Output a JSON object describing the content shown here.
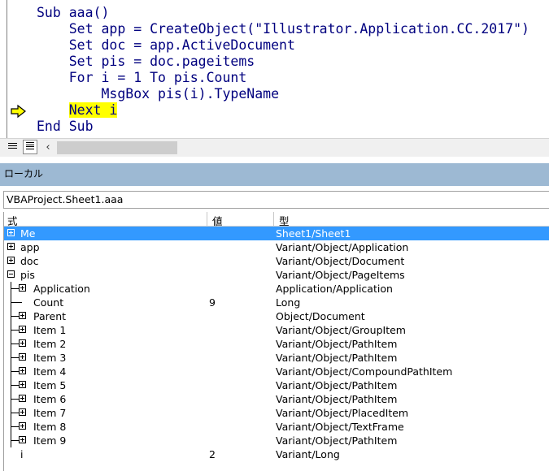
{
  "code": {
    "lines": [
      {
        "pre": "Sub aaa()",
        "hl": "",
        "post": ""
      },
      {
        "pre": "    Set app = CreateObject(\"Illustrator.Application.CC.2017\")",
        "hl": "",
        "post": ""
      },
      {
        "pre": "    Set doc = app.ActiveDocument",
        "hl": "",
        "post": ""
      },
      {
        "pre": "    Set pis = doc.pageitems",
        "hl": "",
        "post": ""
      },
      {
        "pre": "    For i = 1 To pis.Count",
        "hl": "",
        "post": ""
      },
      {
        "pre": "        MsgBox pis(i).TypeName",
        "hl": "",
        "post": ""
      },
      {
        "pre": "    ",
        "hl": "Next i",
        "post": ""
      },
      {
        "pre": "End Sub",
        "hl": "",
        "post": ""
      }
    ],
    "highlight_color": "#ffff00",
    "text_color": "#00007f"
  },
  "locals": {
    "title": "ローカル",
    "context": "VBAProject.Sheet1.aaa",
    "columns": [
      "式",
      "値",
      "型"
    ],
    "rows": [
      {
        "expr": "Me",
        "value": "",
        "type": "Sheet1/Sheet1",
        "toggle": "plus",
        "level": 0,
        "selected": true
      },
      {
        "expr": "app",
        "value": "",
        "type": "Variant/Object/Application",
        "toggle": "plus",
        "level": 0
      },
      {
        "expr": "doc",
        "value": "",
        "type": "Variant/Object/Document",
        "toggle": "plus",
        "level": 0
      },
      {
        "expr": "pis",
        "value": "",
        "type": "Variant/Object/PageItems",
        "toggle": "minus",
        "level": 0
      },
      {
        "expr": "Application",
        "value": "",
        "type": "Application/Application",
        "toggle": "plus",
        "level": 1
      },
      {
        "expr": "Count",
        "value": "9",
        "type": "Long",
        "toggle": "none",
        "level": 1
      },
      {
        "expr": "Parent",
        "value": "",
        "type": "Object/Document",
        "toggle": "plus",
        "level": 1
      },
      {
        "expr": "Item 1",
        "value": "",
        "type": "Variant/Object/GroupItem",
        "toggle": "plus",
        "level": 1
      },
      {
        "expr": "Item 2",
        "value": "",
        "type": "Variant/Object/PathItem",
        "toggle": "plus",
        "level": 1
      },
      {
        "expr": "Item 3",
        "value": "",
        "type": "Variant/Object/PathItem",
        "toggle": "plus",
        "level": 1
      },
      {
        "expr": "Item 4",
        "value": "",
        "type": "Variant/Object/CompoundPathItem",
        "toggle": "plus",
        "level": 1
      },
      {
        "expr": "Item 5",
        "value": "",
        "type": "Variant/Object/PathItem",
        "toggle": "plus",
        "level": 1
      },
      {
        "expr": "Item 6",
        "value": "",
        "type": "Variant/Object/PathItem",
        "toggle": "plus",
        "level": 1
      },
      {
        "expr": "Item 7",
        "value": "",
        "type": "Variant/Object/PlacedItem",
        "toggle": "plus",
        "level": 1
      },
      {
        "expr": "Item 8",
        "value": "",
        "type": "Variant/Object/TextFrame",
        "toggle": "plus",
        "level": 1
      },
      {
        "expr": "Item 9",
        "value": "",
        "type": "Variant/Object/PathItem",
        "toggle": "plus",
        "level": 1
      },
      {
        "expr": "i",
        "value": "2",
        "type": "Variant/Long",
        "toggle": "none",
        "level": 0
      }
    ]
  },
  "icons": {
    "execution_arrow": "execution-pointer-icon",
    "procedure_view": "procedure-view-icon",
    "full_module_view": "full-module-view-icon",
    "scroll_left": "chevron-left-icon"
  },
  "colors": {
    "selection": "#3399ff",
    "locals_title_bar": "#9db9d3",
    "execution_arrow": "#ffff00"
  }
}
